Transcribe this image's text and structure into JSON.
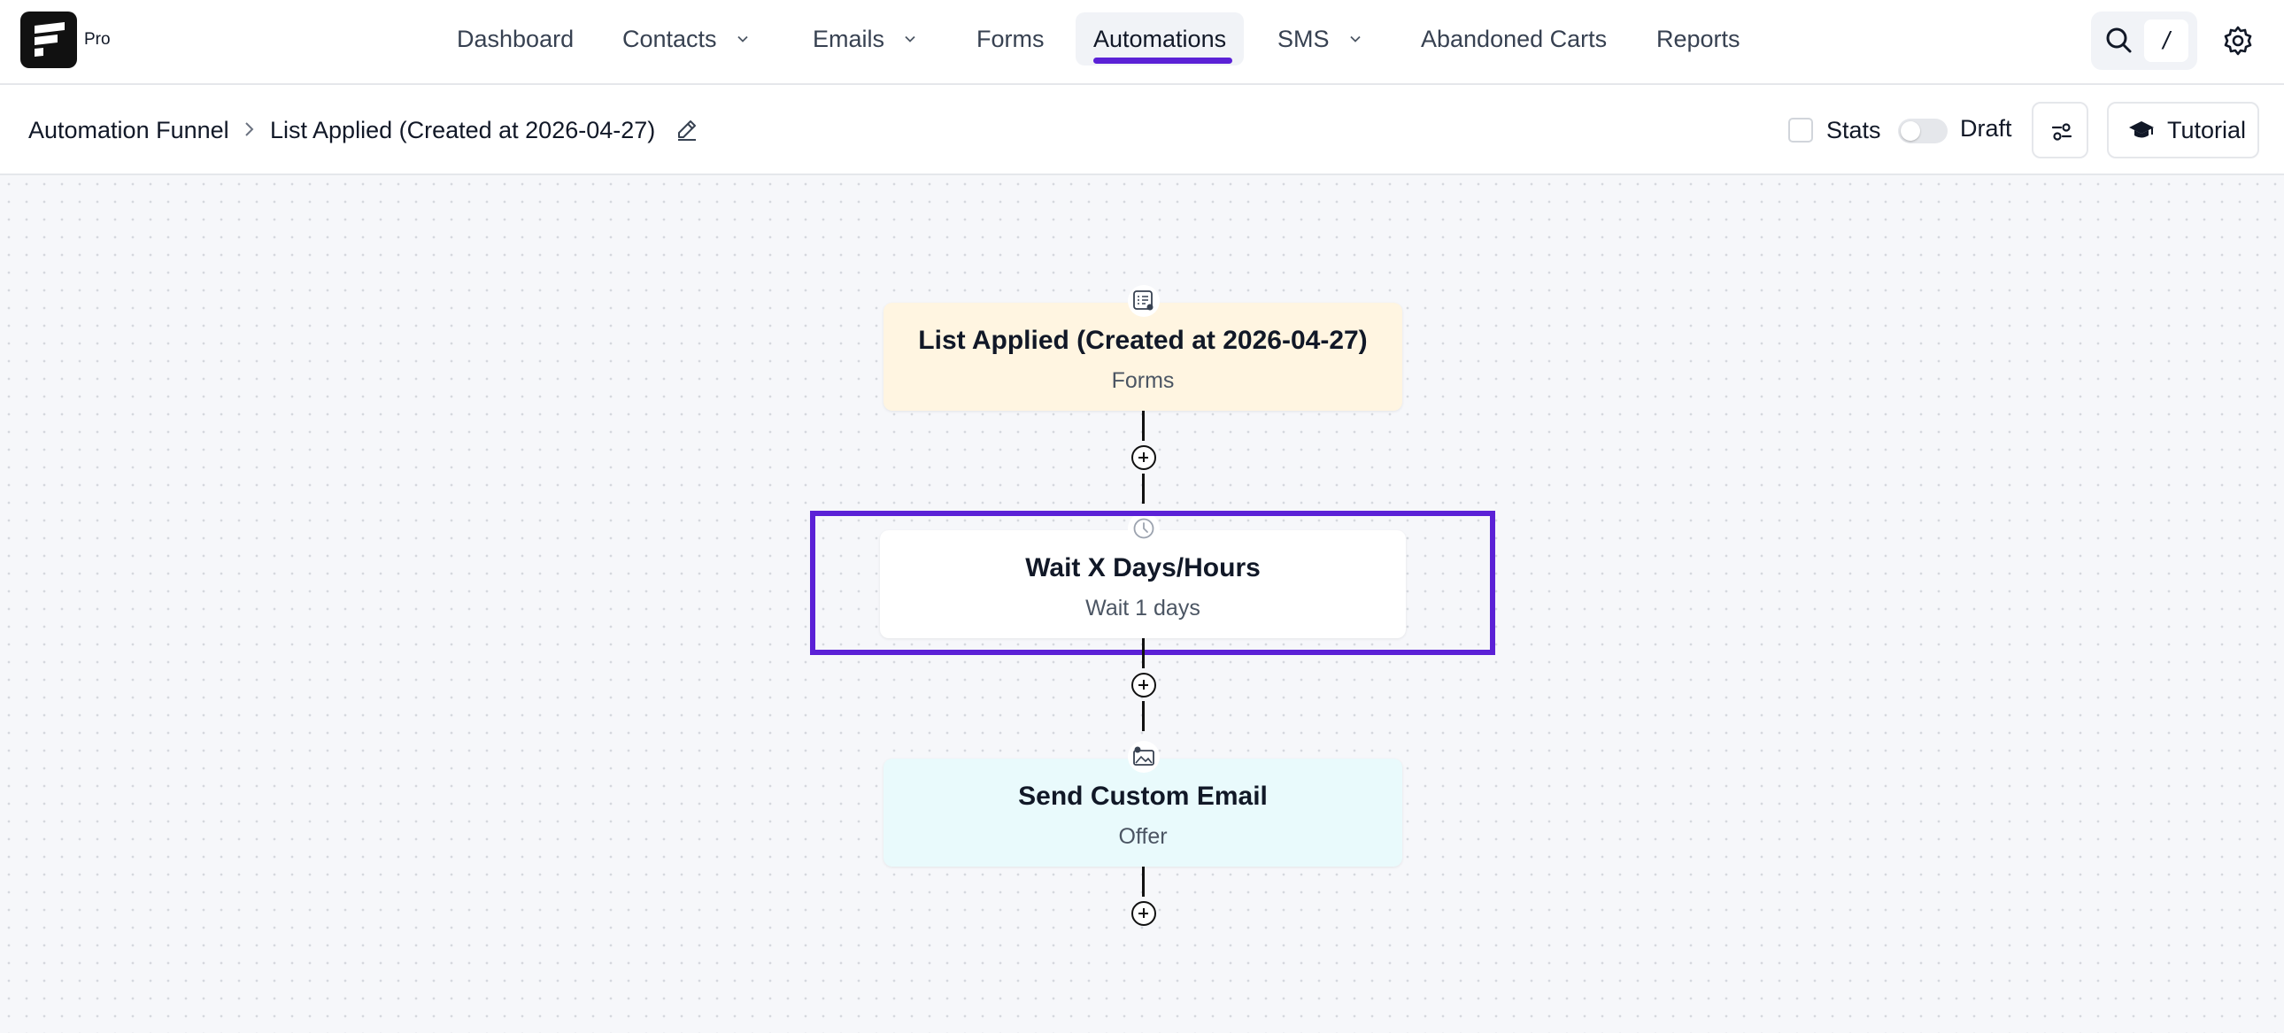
{
  "brand": {
    "tier_label": "Pro"
  },
  "nav": {
    "items": [
      {
        "label": "Dashboard"
      },
      {
        "label": "Contacts"
      },
      {
        "label": "Emails"
      },
      {
        "label": "Forms"
      },
      {
        "label": "Automations"
      },
      {
        "label": "SMS"
      },
      {
        "label": "Abandoned Carts"
      },
      {
        "label": "Reports"
      }
    ],
    "active": "Automations",
    "search_shortcut": "/"
  },
  "breadcrumb": {
    "parent": "Automation Funnel",
    "current": "List Applied (Created at 2026-04-27)"
  },
  "toolbar": {
    "stats_label": "Stats",
    "stats_checked": false,
    "draft_label": "Draft",
    "draft_on": false,
    "tutorial_label": "Tutorial"
  },
  "funnel": {
    "nodes": [
      {
        "title": "List Applied (Created at 2026-04-27)",
        "subtitle": "Forms",
        "icon": "form-list-icon",
        "color": "#fff5e1"
      },
      {
        "title": "Wait X Days/Hours",
        "subtitle": "Wait 1 days",
        "icon": "clock-icon",
        "color": "#ffffff"
      },
      {
        "title": "Send Custom Email",
        "subtitle": "Offer",
        "icon": "email-image-icon",
        "color": "#e9fafc"
      }
    ],
    "selected_node": "Wait X Days/Hours"
  },
  "colors": {
    "accent": "#5b21d6",
    "trigger_bg": "#fff5e1",
    "email_bg": "#e9fafc"
  }
}
